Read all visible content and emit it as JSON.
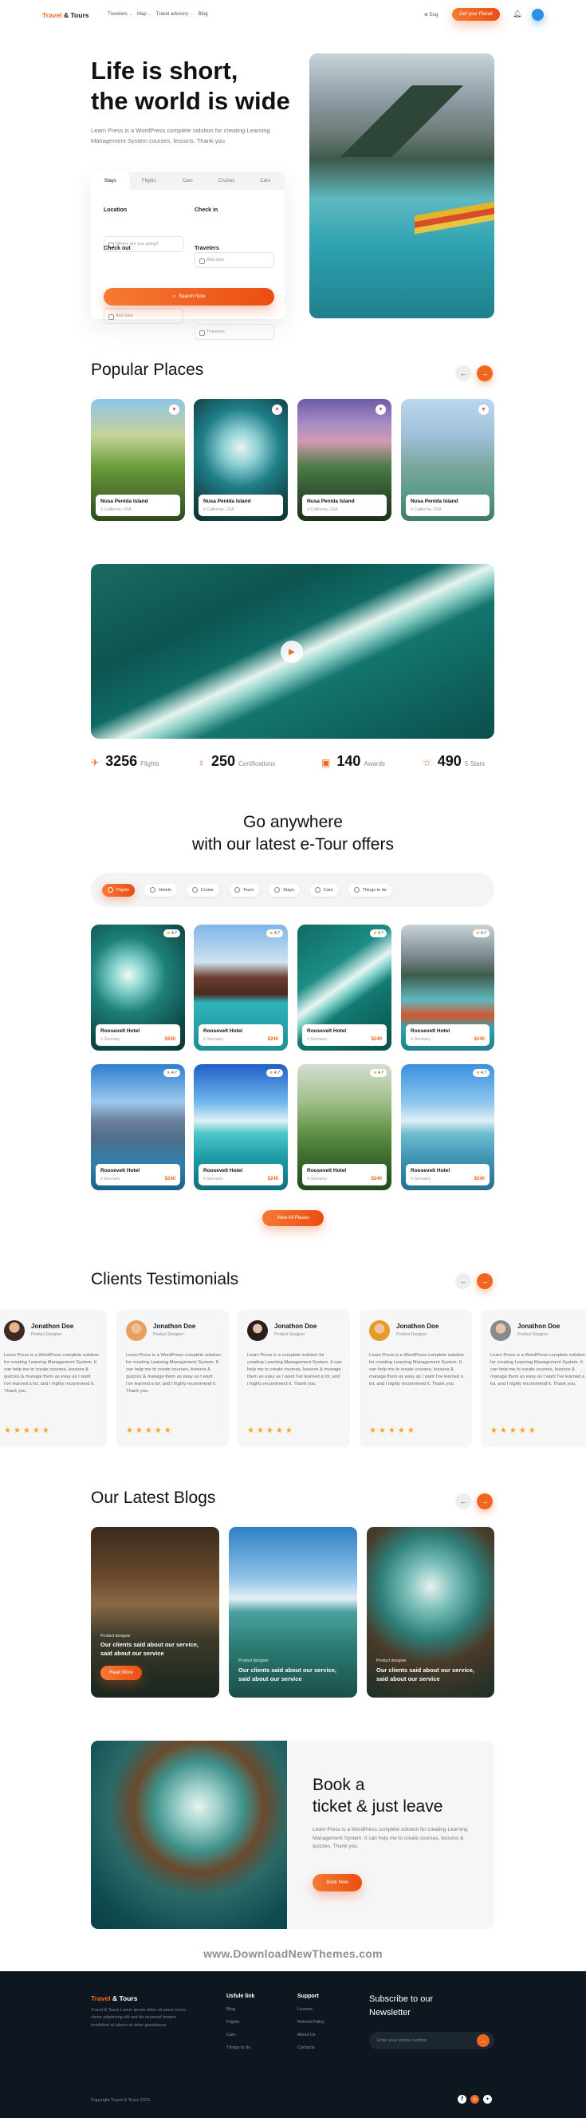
{
  "header": {
    "brand_a": "Travel",
    "brand_b": "& Tours",
    "nav": [
      "Travelers",
      "Map",
      "Travel advisory",
      "Blog"
    ],
    "lang": "Eng",
    "cta": "Get your Planet"
  },
  "hero": {
    "title_1": "Life is short,",
    "title_2": "the world is wide",
    "text": "Learn Press is a WordPress complete solution for creating Learning Management System courses, lessons. Thank you",
    "tabs": [
      "Stays",
      "Flights",
      "Cars",
      "Cruises",
      "Cars"
    ],
    "location_label": "Location",
    "location_ph": "Where are you going?",
    "checkin_label": "Check in",
    "checkin_ph": "Add date",
    "checkout_label": "Check out",
    "checkout_ph": "Add date",
    "travelers_label": "Travelers",
    "travelers_ph": "Travelers",
    "search": "Search Now"
  },
  "popular": {
    "title": "Popular Places",
    "cards": [
      {
        "name": "Nusa Penida Island",
        "loc": "California, USA"
      },
      {
        "name": "Nusa Penida Island",
        "loc": "California, USA"
      },
      {
        "name": "Nusa Penida Island",
        "loc": "California, USA"
      },
      {
        "name": "Nusa Penida Island",
        "loc": "California, USA"
      }
    ]
  },
  "stats": [
    {
      "n": "3256",
      "l": "Flights"
    },
    {
      "n": "250",
      "l": "Certifications"
    },
    {
      "n": "140",
      "l": "Awards"
    },
    {
      "n": "490",
      "l": "5 Stars"
    }
  ],
  "offers": {
    "title_1": "Go anywhere",
    "title_2": "with our latest e-Tour offers",
    "filters": [
      "Flights",
      "Hotels",
      "Cruise",
      "Tours",
      "Stays",
      "Cars",
      "Things to do"
    ],
    "hotel": "Roosevelt Hotel",
    "country": "Germany",
    "price": "$240",
    "rating": "4.7",
    "view_all": "View All Places"
  },
  "testimonials": {
    "title": "Clients Testimonials",
    "items": [
      {
        "name": "Jonathon Doe",
        "role": "Product Designer",
        "text": "Learn Press is a WordPress complete solution for creating Learning Management System. It can help me to create courses, lessons & quizzes & manage them as easy as I want I've learned a lot, and I highly recommend it. Thank you."
      },
      {
        "name": "Jonathon Doe",
        "role": "Product Designer",
        "text": "Learn Press is a WordPress complete solution for creating Learning Management System. It can help me to create courses, lessons & quizzes & manage them as easy as I want I've learned a lot, and I highly recommend it. Thank you."
      },
      {
        "name": "Jonathon Doe",
        "role": "Product Designer",
        "text": "Learn Press is a complete solution for creating Learning Management System. It can help me to create courses, lessons & manage them as easy as I want I've learned a lot, and I highly recommend it. Thank you."
      },
      {
        "name": "Jonathon Doe",
        "role": "Product Designer",
        "text": "Learn Press is a WordPress complete solution for creating Learning Management System. It can help me to create courses, lessons & manage them as easy as I want I've learned a lot, and I highly recommend it. Thank you."
      },
      {
        "name": "Jonathon Doe",
        "role": "Product Designer",
        "text": "Learn Press is a WordPress complete solution for creating Learning Management System. It can help me to create courses, lessons & manage them as easy as I want I've learned a lot, and I highly recommend it. Thank you."
      }
    ]
  },
  "blogs": {
    "title": "Our Latest Blogs",
    "items": [
      {
        "cat": "Product designer",
        "title": "Our clients said about our service, said about our service",
        "btn": "Read More"
      },
      {
        "cat": "Product designer",
        "title": "Our clients said about our service, said about our service"
      },
      {
        "cat": "Product designer",
        "title": "Our clients said about our service, said about our service"
      }
    ]
  },
  "book": {
    "title_1": "Book a",
    "title_2": "ticket & just leave",
    "text": "Learn Press is a WordPress complete solution for creating Learning Management System. It can help me to create courses, lessons & quizzes. Thank you.",
    "btn": "Book Now"
  },
  "watermark": "www.DownloadNewThemes.com",
  "footer": {
    "brand_a": "Travel",
    "brand_b": "& Tours",
    "desc": "Travel & Tours Lorem ipsum dolor sit amet conse ctetur adipiscing elit sed do eiusmod tempor incididunt ut labore et dolor gravidanus",
    "col1_title": "Usfule link",
    "col1": [
      "Blog",
      "Flights",
      "Cars",
      "Things to do"
    ],
    "col2_title": "Support",
    "col2": [
      "License",
      "Refund Policy",
      "About Us",
      "Contacts"
    ],
    "sub_title_1": "Subscribe to our",
    "sub_title_2": "Newsletter",
    "sub_ph": "Enter your phone number",
    "copyright": "Copyright Travel & Tours 2023"
  },
  "colors": {
    "accent": "#f2671f",
    "footer_bg": "#0e1720"
  }
}
